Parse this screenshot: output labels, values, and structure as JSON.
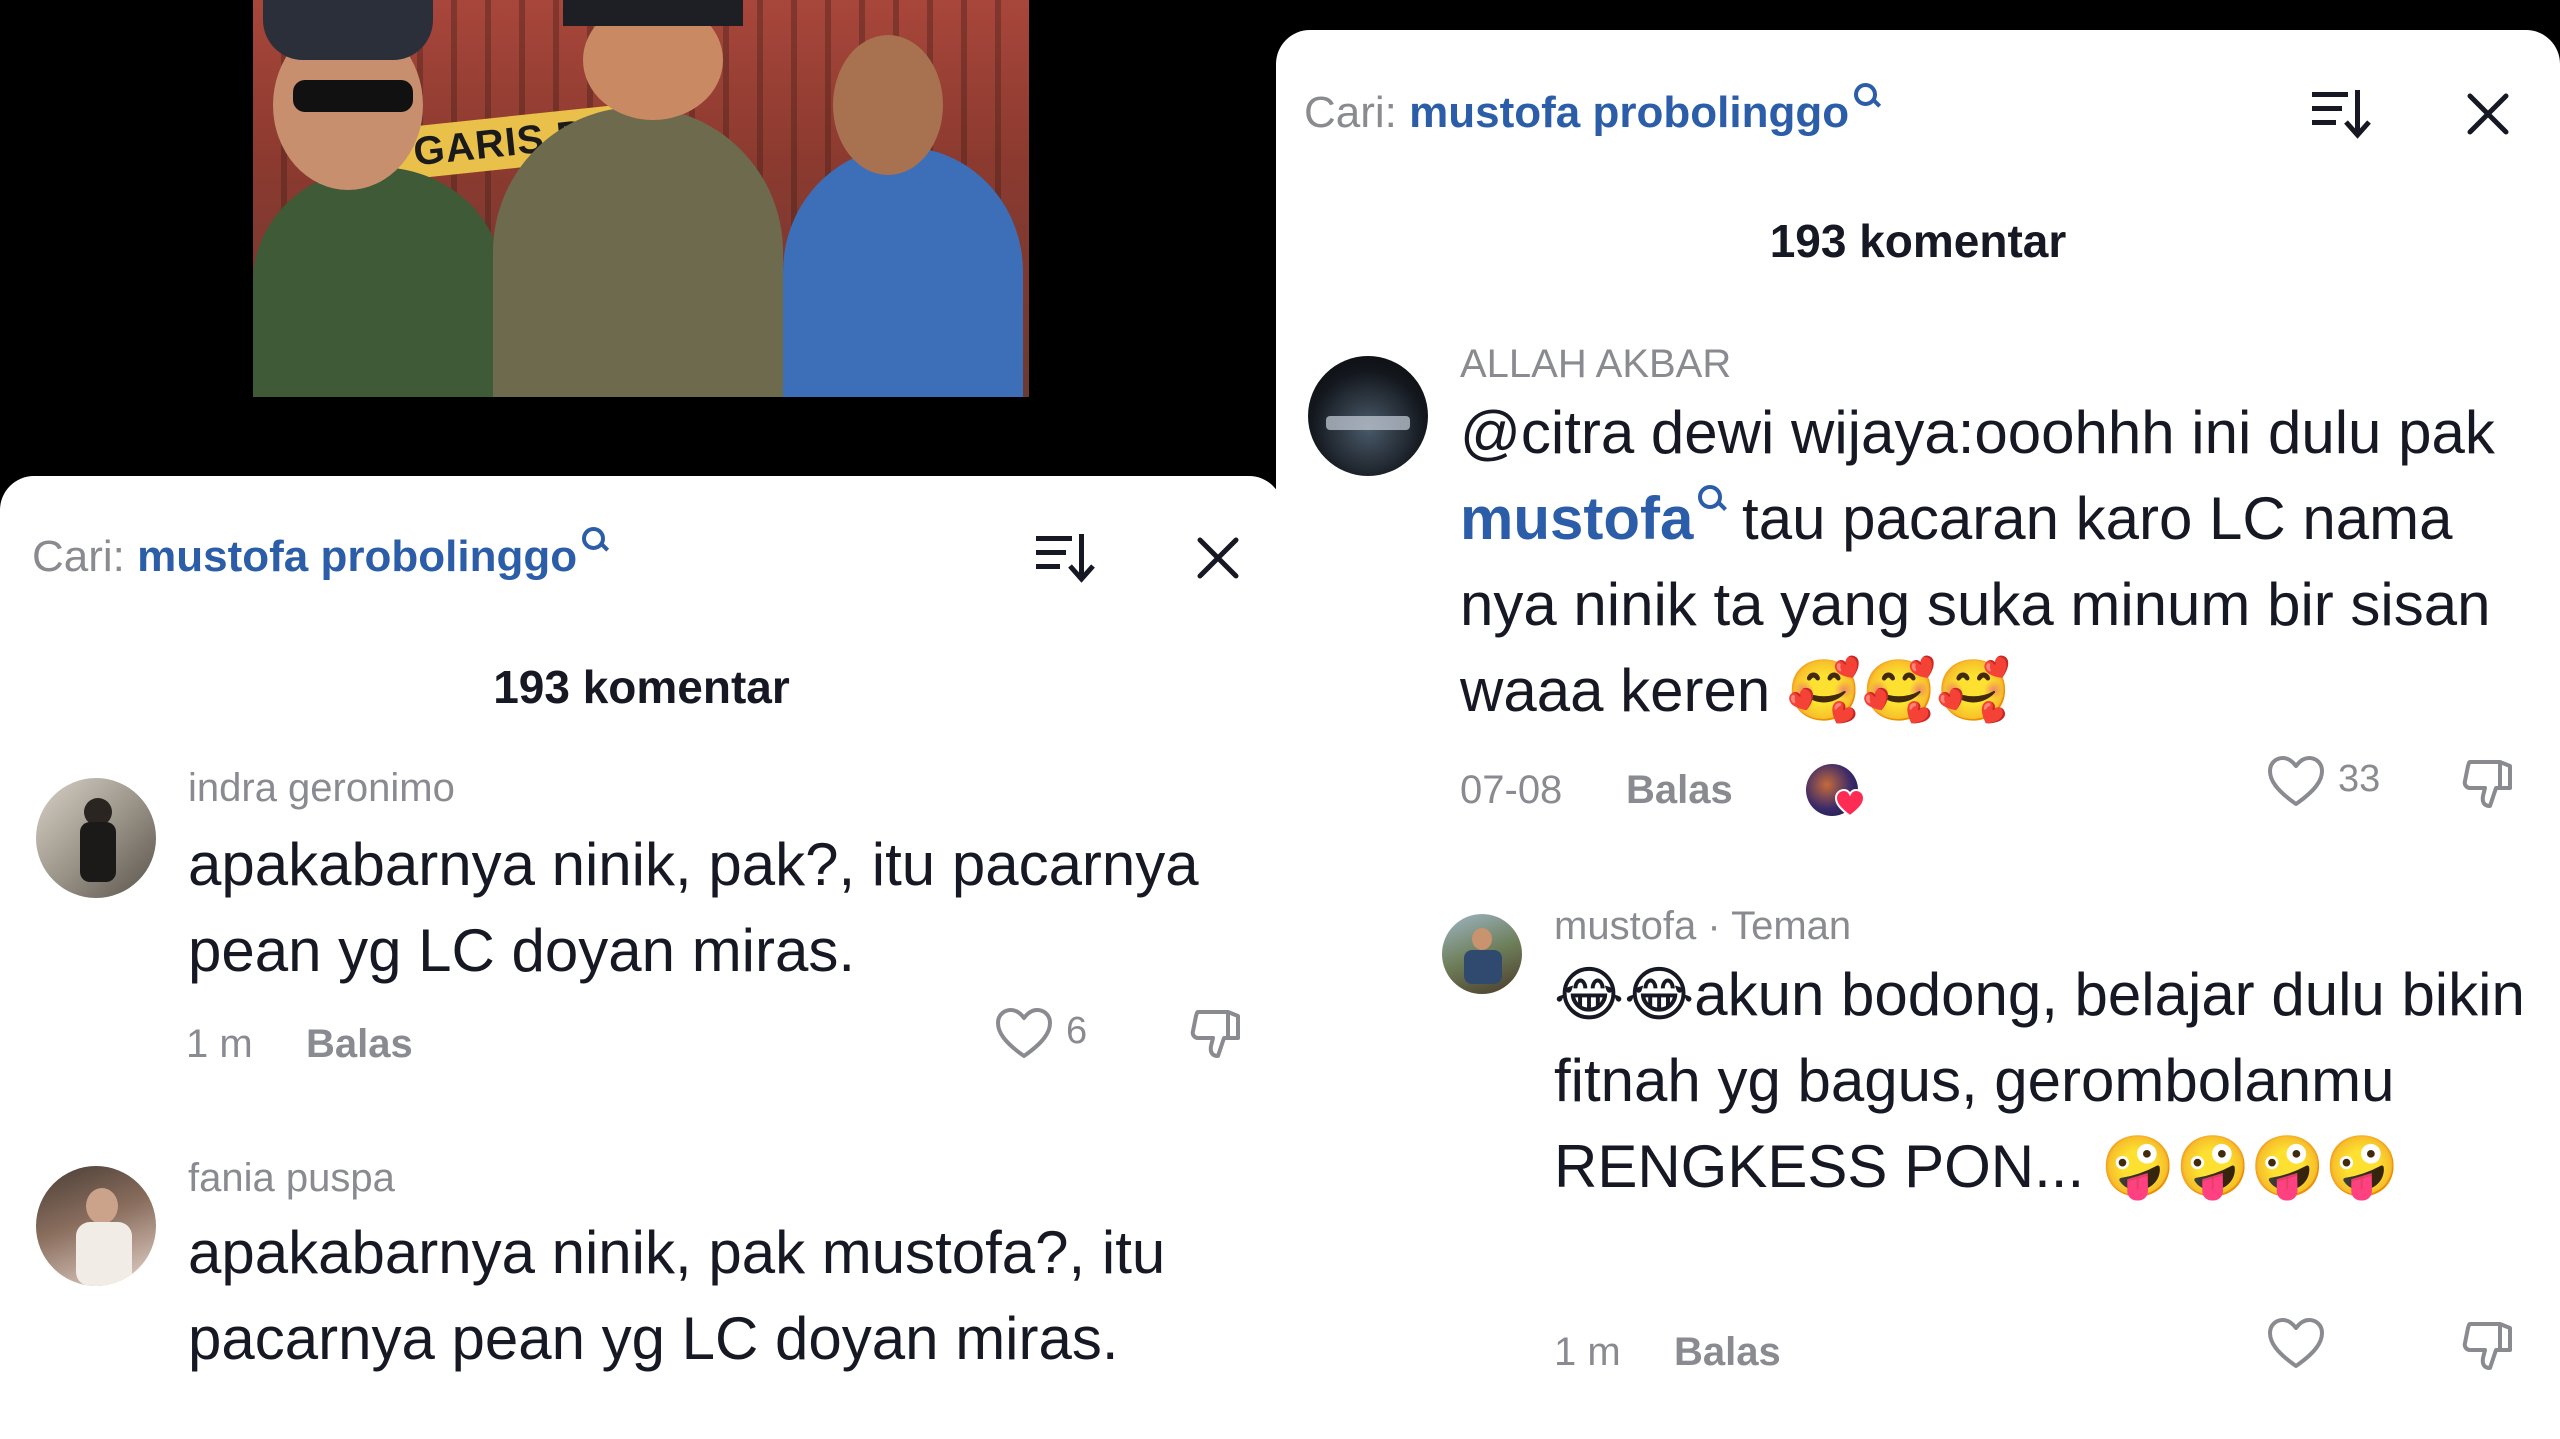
{
  "left_panel": {
    "search": {
      "prefix": "Cari:",
      "term": "mustofa probolinggo"
    },
    "comment_count": "193 komentar",
    "comments": [
      {
        "username": "indra geronimo",
        "text": "apakabarnya ninik, pak?, itu pacarnya pean yg LC doyan miras.",
        "time": "1 m",
        "reply": "Balas",
        "likes": "6"
      },
      {
        "username": "fania puspa",
        "text": "apakabarnya ninik, pak mustofa?, itu pacarnya pean yg LC doyan miras."
      }
    ]
  },
  "right_panel": {
    "search": {
      "prefix": "Cari:",
      "term": "mustofa probolinggo"
    },
    "comment_count": "193 komentar",
    "comments": [
      {
        "username": "ALLAH AKBAR",
        "text_before": "@citra dewi wijaya:ooohhh ini dulu pak ",
        "mention": "mustofa",
        "text_after": " tau pacaran karo LC nama nya ninik ta yang suka minum bir sisan waaa keren 🥰🥰🥰",
        "time": "07-08",
        "reply": "Balas",
        "likes": "33"
      },
      {
        "username": "mustofa · Teman",
        "text": "😂😂akun bodong, belajar dulu bikin fitnah yg bagus, gerombolanmu RENGKESS PON... 🤪🤪🤪🤪",
        "time": "1 m",
        "reply": "Balas"
      }
    ]
  },
  "video": {
    "sign_text": "GARIS P"
  },
  "colors": {
    "accent": "#2b5da8",
    "muted": "#8a8b91",
    "text": "#161823",
    "like_badge": "#fe2c55"
  }
}
